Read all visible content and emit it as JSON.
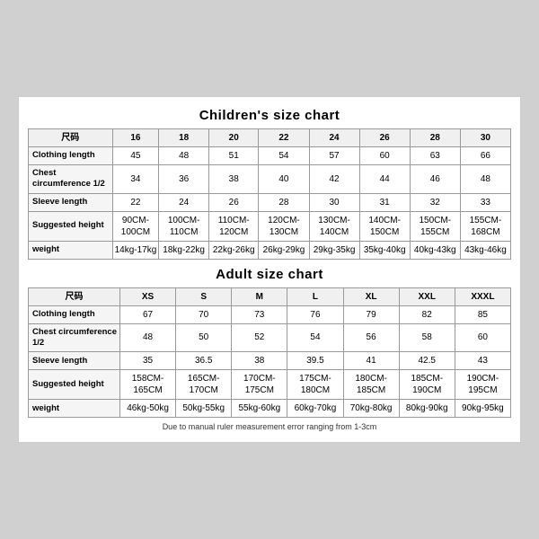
{
  "children_chart": {
    "title": "Children's size chart",
    "columns": [
      "尺码",
      "16",
      "18",
      "20",
      "22",
      "24",
      "26",
      "28",
      "30"
    ],
    "rows": [
      {
        "label": "Clothing length",
        "values": [
          "45",
          "48",
          "51",
          "54",
          "57",
          "60",
          "63",
          "66"
        ]
      },
      {
        "label": "Chest circumference 1/2",
        "values": [
          "34",
          "36",
          "38",
          "40",
          "42",
          "44",
          "46",
          "48"
        ]
      },
      {
        "label": "Sleeve length",
        "values": [
          "22",
          "24",
          "26",
          "28",
          "30",
          "31",
          "32",
          "33"
        ]
      },
      {
        "label": "Suggested height",
        "values": [
          "90CM-100CM",
          "100CM-110CM",
          "110CM-120CM",
          "120CM-130CM",
          "130CM-140CM",
          "140CM-150CM",
          "150CM-155CM",
          "155CM-168CM"
        ]
      },
      {
        "label": "weight",
        "values": [
          "14kg-17kg",
          "18kg-22kg",
          "22kg-26kg",
          "26kg-29kg",
          "29kg-35kg",
          "35kg-40kg",
          "40kg-43kg",
          "43kg-46kg"
        ]
      }
    ]
  },
  "adult_chart": {
    "title": "Adult size chart",
    "columns": [
      "尺码",
      "XS",
      "S",
      "M",
      "L",
      "XL",
      "XXL",
      "XXXL"
    ],
    "rows": [
      {
        "label": "Clothing length",
        "values": [
          "67",
          "70",
          "73",
          "76",
          "79",
          "82",
          "85"
        ]
      },
      {
        "label": "Chest circumference 1/2",
        "values": [
          "48",
          "50",
          "52",
          "54",
          "56",
          "58",
          "60"
        ]
      },
      {
        "label": "Sleeve length",
        "values": [
          "35",
          "36.5",
          "38",
          "39.5",
          "41",
          "42.5",
          "43"
        ]
      },
      {
        "label": "Suggested height",
        "values": [
          "158CM-165CM",
          "165CM-170CM",
          "170CM-175CM",
          "175CM-180CM",
          "180CM-185CM",
          "185CM-190CM",
          "190CM-195CM"
        ]
      },
      {
        "label": "weight",
        "values": [
          "46kg-50kg",
          "50kg-55kg",
          "55kg-60kg",
          "60kg-70kg",
          "70kg-80kg",
          "80kg-90kg",
          "90kg-95kg"
        ]
      }
    ]
  },
  "footer_note": "Due to manual ruler measurement error ranging from 1-3cm"
}
